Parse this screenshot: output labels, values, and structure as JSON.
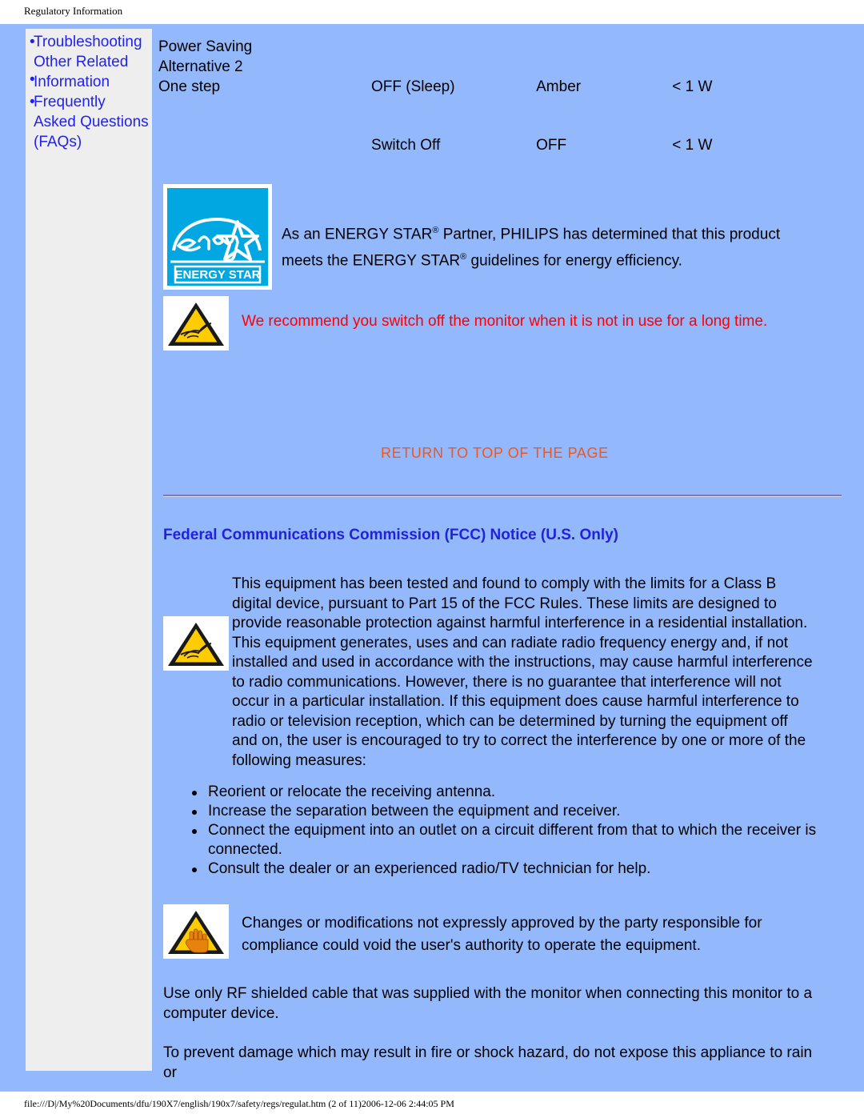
{
  "print_header": {
    "title": "Regulatory Information"
  },
  "sidebar": {
    "items": [
      {
        "label": "Troubleshooting",
        "icon": "bullet-icon"
      },
      {
        "label": "Other Related Information",
        "icon": "bullet-icon"
      },
      {
        "label": "Frequently Asked Questions (FAQs)",
        "icon": "bullet-icon"
      }
    ]
  },
  "power_saving": {
    "label_lines": [
      "Power Saving",
      "Alternative 2",
      "One step"
    ],
    "rows": [
      {
        "mode": "OFF (Sleep)",
        "led": "Amber",
        "power": "< 1 W"
      },
      {
        "mode": "Switch Off",
        "led": "OFF",
        "power": "< 1 W"
      }
    ]
  },
  "energy_star": {
    "logo_alt": "ENERGY STAR",
    "logo_wordmark": "ENERGY STAR",
    "logo_script": "energy",
    "text_line_1_a": "As an ENERGY STAR",
    "text_line_1_b": " Partner, PHILIPS has determined that this product",
    "text_line_2_a": "meets the ENERGY STAR",
    "text_line_2_b": " guidelines for energy efficiency.",
    "registered_mark": "®"
  },
  "warning_recommend": {
    "icon": "warning-triangle-icon",
    "text": "We recommend you switch off the monitor when it is not in use for a long time."
  },
  "return_top": {
    "label": "RETURN TO TOP OF THE PAGE"
  },
  "fcc": {
    "heading": "Federal Communications Commission (FCC) Notice (U.S. Only)",
    "icon": "warning-triangle-icon",
    "body": "This equipment has been tested and found to comply with the limits for a Class B digital device, pursuant to Part 15 of the FCC Rules. These limits are designed to provide reasonable protection against harmful interference in a residential installation. This equipment generates, uses and can radiate radio frequency energy and, if not installed and used in accordance with the instructions, may cause harmful interference to radio communications. However, there is no guarantee that interference will not occur in a particular installation. If this equipment does cause harmful interference to radio or television reception, which can be determined by turning the equipment off and on, the user is encouraged to try to correct the interference by one or more of the following measures:",
    "measures": [
      "Reorient or relocate the receiving antenna.",
      "Increase the separation between the equipment and receiver.",
      "Connect the equipment into an outlet on a circuit different from that to which the receiver is connected.",
      "Consult the dealer or an experienced radio/TV technician for help."
    ],
    "changes_icon": "warning-triangle-hand-icon",
    "changes_notice": "Changes or modifications not expressly approved by the party responsible for compliance could void the user's authority to operate the equipment.",
    "rf_cable_notice": "Use only RF shielded cable that was supplied with the monitor when connecting this monitor to a computer device.",
    "rain_notice": "To prevent damage which may result in fire or shock hazard, do not expose this appliance to rain or"
  },
  "footer": {
    "status": "file:///D|/My%20Documents/dfu/190X7/english/190x7/safety/regs/regulat.htm (2 of 11)2006-12-06 2:44:05 PM"
  },
  "colors": {
    "page_background": "#93b8fb",
    "sidebar_background": "#eeeeee",
    "link_blue": "#2222ee",
    "heading_blue": "#2222dd",
    "warning_red": "#ff0000",
    "return_top_orange": "#f2561a",
    "energy_star_cyan": "#00a7e1",
    "warning_yellow": "#ffcc00"
  }
}
